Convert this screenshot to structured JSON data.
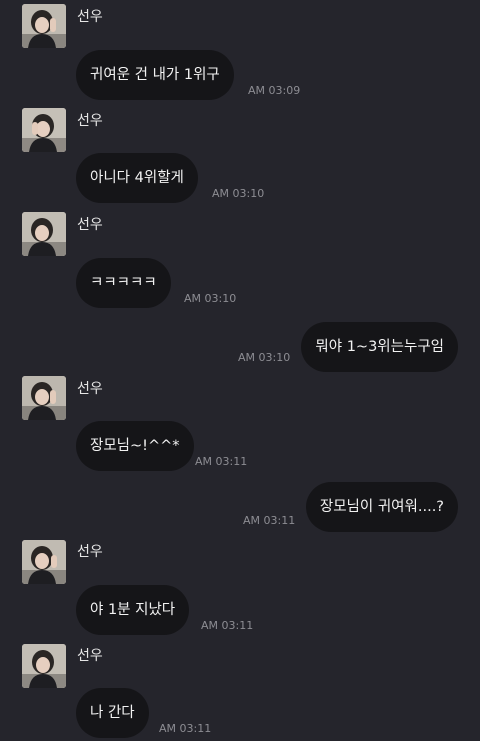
{
  "sender_name": "선우",
  "messages": [
    {
      "direction": "in",
      "text": "귀여운 건 내가 1위구",
      "time": "AM 03:09",
      "show_profile": true
    },
    {
      "direction": "in",
      "text": "아니다 4위할게",
      "time": "AM 03:10",
      "show_profile": true
    },
    {
      "direction": "in",
      "text": "ㅋㅋㅋㅋㅋ",
      "time": "AM 03:10",
      "show_profile": true
    },
    {
      "direction": "out",
      "text": "뭐야 1~3위는누구임",
      "time": "AM 03:10",
      "show_profile": false
    },
    {
      "direction": "in",
      "text": "장모님~!^^*",
      "time": "AM 03:11",
      "show_profile": true
    },
    {
      "direction": "out",
      "text": "장모님이 귀여워....?",
      "time": "AM 03:11",
      "show_profile": false
    },
    {
      "direction": "in",
      "text": "야 1분 지났다",
      "time": "AM 03:11",
      "show_profile": true
    },
    {
      "direction": "in",
      "text": "나 간다",
      "time": "AM 03:11",
      "show_profile": true
    }
  ],
  "colors": {
    "background": "#25252c",
    "bubble": "#151518",
    "text": "#f2f2f2",
    "timestamp": "#8d8d93"
  },
  "avatar_icon": "profile-photo"
}
